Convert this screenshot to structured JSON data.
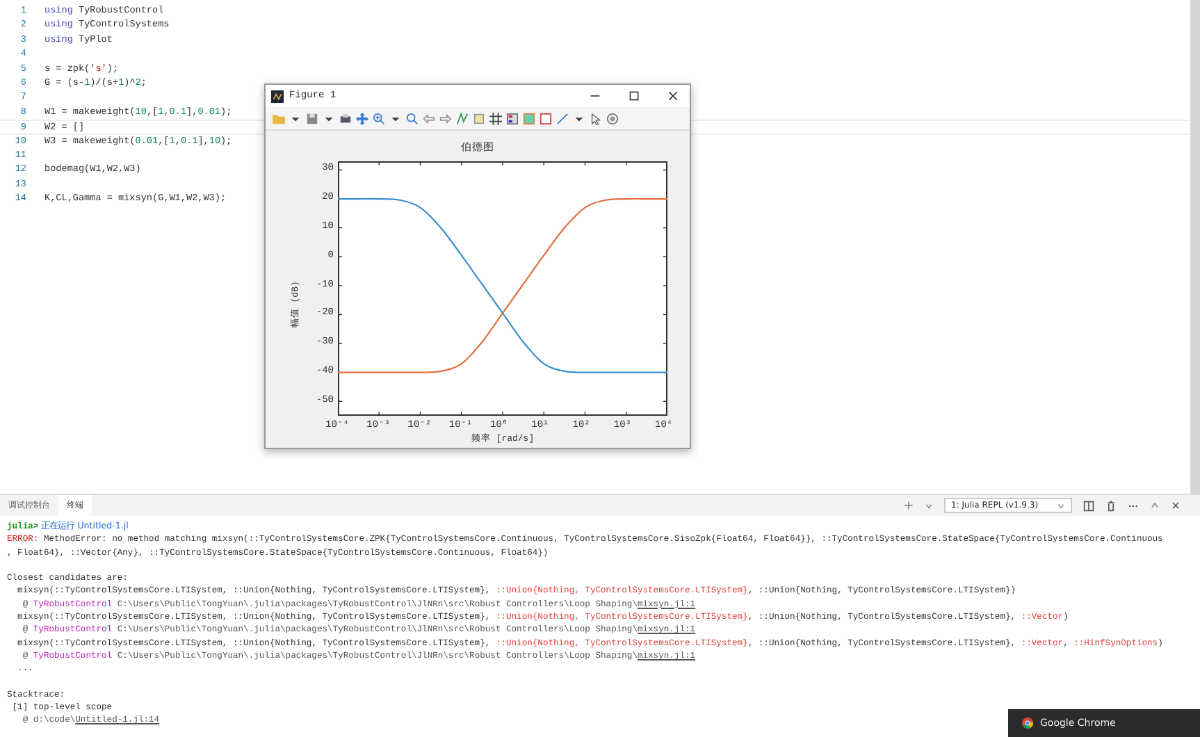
{
  "editor": {
    "lines": [
      {
        "number": "1",
        "selected": false,
        "tokens": [
          {
            "text": "using",
            "kind": "kw"
          },
          {
            "text": " TyRobustControl",
            "kind": "plain"
          }
        ]
      },
      {
        "number": "2",
        "selected": false,
        "tokens": [
          {
            "text": "using",
            "kind": "kw"
          },
          {
            "text": " TyControlSystems",
            "kind": "plain"
          }
        ]
      },
      {
        "number": "3",
        "selected": false,
        "tokens": [
          {
            "text": "using",
            "kind": "kw"
          },
          {
            "text": " TyPlot",
            "kind": "plain"
          }
        ]
      },
      {
        "number": "4",
        "selected": false
      },
      {
        "number": "5",
        "selected": false,
        "tokens": [
          {
            "text": "s = zpk(",
            "kind": "plain"
          },
          {
            "text": "'s'",
            "kind": "str"
          },
          {
            "text": ");",
            "kind": "plain"
          }
        ]
      },
      {
        "number": "6",
        "selected": false,
        "tokens": [
          {
            "text": "G = (s-",
            "kind": "plain"
          },
          {
            "text": "1",
            "kind": "num"
          },
          {
            "text": ")/(s+",
            "kind": "plain"
          },
          {
            "text": "1",
            "kind": "num"
          },
          {
            "text": ")^",
            "kind": "plain"
          },
          {
            "text": "2",
            "kind": "num"
          },
          {
            "text": ";",
            "kind": "plain"
          }
        ]
      },
      {
        "number": "7",
        "selected": false
      },
      {
        "number": "8",
        "selected": false,
        "tokens": [
          {
            "text": "W1 = makeweight(",
            "kind": "plain"
          },
          {
            "text": "10",
            "kind": "num"
          },
          {
            "text": ",[",
            "kind": "plain"
          },
          {
            "text": "1",
            "kind": "num"
          },
          {
            "text": ",",
            "kind": "plain"
          },
          {
            "text": "0.1",
            "kind": "num"
          },
          {
            "text": "],",
            "kind": "plain"
          },
          {
            "text": "0.01",
            "kind": "num"
          },
          {
            "text": ");",
            "kind": "plain"
          }
        ]
      },
      {
        "number": "9",
        "selected": true,
        "tokens": [
          {
            "text": "W2 = []",
            "kind": "plain"
          }
        ]
      },
      {
        "number": "10",
        "selected": false,
        "tokens": [
          {
            "text": "W3 = makeweight(",
            "kind": "plain"
          },
          {
            "text": "0.01",
            "kind": "num"
          },
          {
            "text": ",[",
            "kind": "plain"
          },
          {
            "text": "1",
            "kind": "num"
          },
          {
            "text": ",",
            "kind": "plain"
          },
          {
            "text": "0.1",
            "kind": "num"
          },
          {
            "text": "],",
            "kind": "plain"
          },
          {
            "text": "10",
            "kind": "num"
          },
          {
            "text": ");",
            "kind": "plain"
          }
        ]
      },
      {
        "number": "11",
        "selected": false
      },
      {
        "number": "12",
        "selected": false,
        "tokens": [
          {
            "text": "bodemag(W1,W2,W3)",
            "kind": "plain"
          }
        ]
      },
      {
        "number": "13",
        "selected": false
      },
      {
        "number": "14",
        "selected": false,
        "tokens": [
          {
            "text": "K,CL,Gamma = mixsyn(G,W1,W2,W3);",
            "kind": "plain"
          }
        ]
      }
    ]
  },
  "figure": {
    "title": "Figure 1",
    "chart_data": {
      "type": "line",
      "title": "伯德图",
      "xlabel": "频率 [rad/s]",
      "ylabel": "幅值 (dB)",
      "categories": [
        "10⁻⁴",
        null,
        "10⁻³",
        null,
        "10⁻²",
        null,
        "10⁻¹",
        null,
        "10⁰",
        null,
        "10¹",
        null,
        "10²",
        null,
        "10³",
        null,
        "10⁴"
      ],
      "series": [
        {
          "color": "#3b8fd0",
          "values": [
            20,
            20,
            20,
            19.6,
            17,
            10,
            0.5,
            -9.5,
            -19.5,
            -29.5,
            -37,
            -39.6,
            -40,
            -40,
            -40,
            -40,
            -40
          ]
        },
        {
          "color": "#e0703f",
          "values": [
            -40,
            -40,
            -40,
            -40,
            -40,
            -39.6,
            -37,
            -29.5,
            -19.5,
            -9.5,
            0.5,
            10,
            17,
            19.6,
            20,
            20,
            20
          ]
        }
      ],
      "ylim": [
        -55,
        33
      ],
      "yticks": [
        30,
        20,
        10,
        0,
        -10,
        -20,
        -30,
        -40,
        -50
      ]
    }
  },
  "panel": {
    "tabs": [
      {
        "label": "调试控制台",
        "selected": false
      },
      {
        "label": "终端",
        "selected": true
      }
    ],
    "terminal_selector": "1: Julia REPL (v1.9.3)",
    "lines": [
      {
        "gap_before": false,
        "segments": [
          {
            "text": "julia>",
            "kind": "prompt"
          },
          {
            "text": " 正在运行 Untitled-1.jl",
            "kind": "info"
          }
        ]
      },
      {
        "gap_before": false,
        "segments": [
          {
            "text": "ERROR:",
            "kind": "error"
          },
          {
            "text": " MethodError: no method matching mixsyn(::TyControlSystemsCore.ZPK{TyControlSystemsCore.Continuous, TyControlSystemsCore.SisoZpk{Float64, Float64}}, ::TyControlSystemsCore.StateSpace{TyControlSystemsCore.Continuous",
            "kind": "plain"
          }
        ]
      },
      {
        "gap_before": false,
        "segments": [
          {
            "text": ", Float64}, ::Vector{Any}, ::TyControlSystemsCore.StateSpace{TyControlSystemsCore.Continuous, Float64})",
            "kind": "plain"
          }
        ]
      },
      {
        "gap_before": true,
        "segments": [
          {
            "text": "Closest candidates are:",
            "kind": "plain"
          }
        ]
      },
      {
        "gap_before": false,
        "segments": [
          {
            "text": "  mixsyn(::TyControlSystemsCore.LTISystem, ::Union{Nothing, TyControlSystemsCore.LTISystem}, ",
            "kind": "plain"
          },
          {
            "text": "::Union{Nothing, TyControlSystemsCore.LTISystem}",
            "kind": "type"
          },
          {
            "text": ", ::Union{Nothing, TyControlSystemsCore.LTISystem})",
            "kind": "plain"
          }
        ]
      },
      {
        "gap_before": false,
        "segments": [
          {
            "text": "   @ ",
            "kind": "dim"
          },
          {
            "text": "TyRobustControl",
            "kind": "module"
          },
          {
            "text": " C:\\Users\\Public\\TongYuan\\.julia\\packages\\TyRobustControl\\JlNRn\\src\\Robust Controllers\\Loop Shaping\\",
            "kind": "dim"
          },
          {
            "text": "mixsyn.jl:1",
            "kind": "link"
          }
        ]
      },
      {
        "gap_before": false,
        "segments": [
          {
            "text": "  mixsyn(::TyControlSystemsCore.LTISystem, ::Union{Nothing, TyControlSystemsCore.LTISystem}, ",
            "kind": "plain"
          },
          {
            "text": "::Union{Nothing, TyControlSystemsCore.LTISystem}",
            "kind": "type"
          },
          {
            "text": ", ::Union{Nothing, TyControlSystemsCore.LTISystem}, ",
            "kind": "plain"
          },
          {
            "text": "::Vector",
            "kind": "type"
          },
          {
            "text": ")",
            "kind": "plain"
          }
        ]
      },
      {
        "gap_before": false,
        "segments": [
          {
            "text": "   @ ",
            "kind": "dim"
          },
          {
            "text": "TyRobustControl",
            "kind": "module"
          },
          {
            "text": " C:\\Users\\Public\\TongYuan\\.julia\\packages\\TyRobustControl\\JlNRn\\src\\Robust Controllers\\Loop Shaping\\",
            "kind": "dim"
          },
          {
            "text": "mixsyn.jl:1",
            "kind": "link"
          }
        ]
      },
      {
        "gap_before": false,
        "segments": [
          {
            "text": "  mixsyn(::TyControlSystemsCore.LTISystem, ::Union{Nothing, TyControlSystemsCore.LTISystem}, ",
            "kind": "plain"
          },
          {
            "text": "::Union{Nothing, TyControlSystemsCore.LTISystem}",
            "kind": "type"
          },
          {
            "text": ", ::Union{Nothing, TyControlSystemsCore.LTISystem}, ",
            "kind": "plain"
          },
          {
            "text": "::Vector",
            "kind": "type"
          },
          {
            "text": ", ",
            "kind": "plain"
          },
          {
            "text": "::HinfSynOptions",
            "kind": "type"
          },
          {
            "text": ")",
            "kind": "plain"
          }
        ]
      },
      {
        "gap_before": false,
        "segments": [
          {
            "text": "   @ ",
            "kind": "dim"
          },
          {
            "text": "TyRobustControl",
            "kind": "module"
          },
          {
            "text": " C:\\Users\\Public\\TongYuan\\.julia\\packages\\TyRobustControl\\JlNRn\\src\\Robust Controllers\\Loop Shaping\\",
            "kind": "dim"
          },
          {
            "text": "mixsyn.jl:1",
            "kind": "link"
          }
        ]
      },
      {
        "gap_before": false,
        "segments": [
          {
            "text": "  ...",
            "kind": "plain"
          }
        ]
      },
      {
        "gap_before": true,
        "segments": [
          {
            "text": "Stacktrace:",
            "kind": "plain"
          }
        ]
      },
      {
        "gap_before": false,
        "segments": [
          {
            "text": " [1] top-level scope",
            "kind": "plain"
          }
        ]
      },
      {
        "gap_before": false,
        "segments": [
          {
            "text": "   @ d:\\code\\",
            "kind": "dim"
          },
          {
            "text": "Untitled-1.jl:14",
            "kind": "link"
          }
        ]
      }
    ]
  },
  "tooltip": {
    "label": "Google Chrome"
  }
}
